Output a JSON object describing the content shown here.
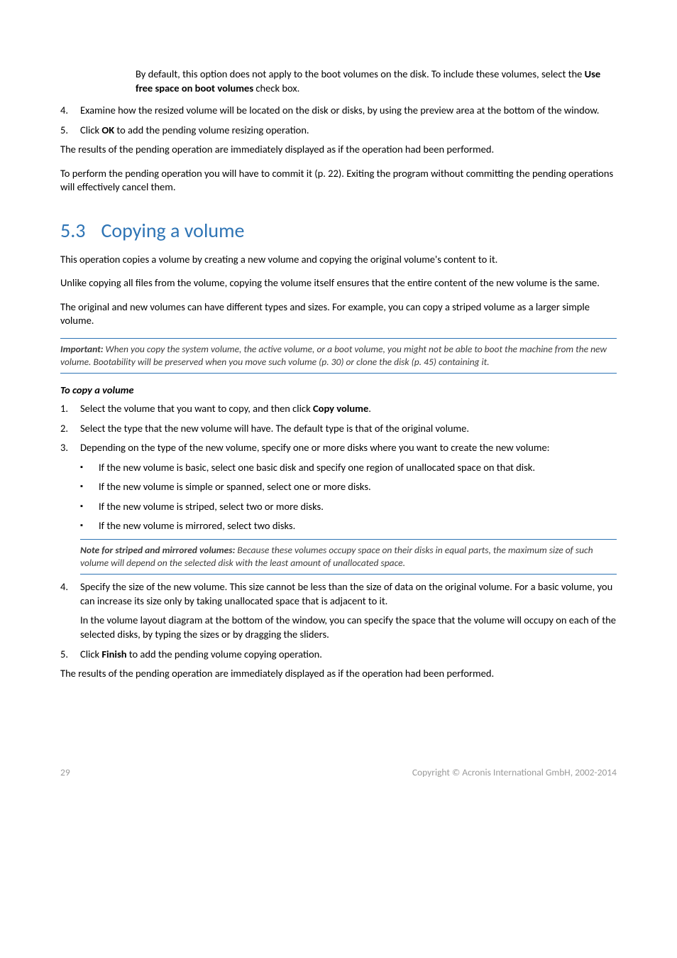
{
  "intro": {
    "indent_para_a": "By default, this option does not apply to the boot volumes on the disk. To include these volumes, select the ",
    "indent_para_a_bold": "Use free space on boot volumes",
    "indent_para_a_tail": " check box.",
    "li4": "Examine how the resized volume will be located on the disk or disks, by using the preview area at the bottom of the window.",
    "li5_a": "Click ",
    "li5_bold": "OK",
    "li5_b": " to add the pending volume resizing operation."
  },
  "after_intro": {
    "p1": "The results of the pending operation are immediately displayed as if the operation had been performed.",
    "p2": "To perform the pending operation you will have to commit it (p. 22). Exiting the program without committing the pending operations will effectively cancel them."
  },
  "section": {
    "number": "5.3",
    "title": "Copying a volume",
    "p1": "This operation copies a volume by creating a new volume and copying the original volume's content to it.",
    "p2": "Unlike copying all files from the volume, copying the volume itself ensures that the entire content of the new volume is the same.",
    "p3": "The original and new volumes can have different types and sizes. For example, you can copy a striped volume as a larger simple volume.",
    "important_label": "Important:",
    "important_body": " When you copy the system volume, the active volume, or a boot volume, you might not be able to boot the machine from the new volume. Bootability will be preserved when you move such volume (p. 30) or clone the disk (p. 45) containing it.",
    "subhead": "To copy a volume",
    "step1_a": "Select the volume that you want to copy, and then click ",
    "step1_bold": "Copy volume",
    "step1_b": ".",
    "step2": "Select the type that the new volume will have. The default type is that of the original volume.",
    "step3": "Depending on the type of the new volume, specify one or more disks where you want to create the new volume:",
    "b1": "If the new volume is basic, select one basic disk and specify one region of unallocated space on that disk.",
    "b2": "If the new volume is simple or spanned, select one or more disks.",
    "b3": "If the new volume is striped, select two or more disks.",
    "b4": "If the new volume is mirrored, select two disks.",
    "note2_label": "Note for striped and mirrored volumes:",
    "note2_body": " Because these volumes occupy space on their disks in equal parts, the maximum size of such volume will depend on the selected disk with the least amount of unallocated space.",
    "step4": "Specify the size of the new volume. This size cannot be less than the size of data on the original volume. For a basic volume, you can increase its size only by taking unallocated space that is adjacent to it.",
    "step4_sub": "In the volume layout diagram at the bottom of the window, you can specify the space that the volume will occupy on each of the selected disks, by typing the sizes or by dragging the sliders.",
    "step5_a": "Click ",
    "step5_bold": "Finish",
    "step5_b": " to add the pending volume copying operation.",
    "closing": "The results of the pending operation are immediately displayed as if the operation had been performed."
  },
  "labels": {
    "n4": "4.",
    "n5": "5.",
    "n1": "1.",
    "n2": "2.",
    "n3": "3.",
    "square": "▪"
  },
  "footer": {
    "page": "29",
    "copyright": "Copyright © Acronis International GmbH, 2002-2014"
  }
}
